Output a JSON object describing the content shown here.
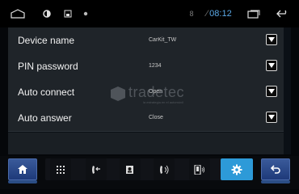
{
  "status_bar": {
    "bluetooth_text": "8",
    "time": "08:12",
    "icons": [
      "home-outline-icon",
      "circle-icon",
      "image-icon",
      "dot-icon",
      "recent-apps-icon",
      "back-arrow-icon"
    ]
  },
  "settings": {
    "rows": [
      {
        "label": "Device name",
        "value": "CarKit_TW"
      },
      {
        "label": "PIN password",
        "value": "1234"
      },
      {
        "label": "Auto connect",
        "value": "Open"
      },
      {
        "label": "Auto answer",
        "value": "Close"
      }
    ]
  },
  "watermark": {
    "text": "tradetec",
    "subtext": "la estrategia en el automóvil"
  },
  "navbar": {
    "buttons": [
      {
        "name": "home",
        "icon": "home-icon"
      },
      {
        "name": "keypad",
        "icon": "keypad-icon"
      },
      {
        "name": "call-log",
        "icon": "call-log-icon"
      },
      {
        "name": "contacts",
        "icon": "contacts-icon"
      },
      {
        "name": "call-transfer",
        "icon": "call-transfer-icon"
      },
      {
        "name": "phone-settings",
        "icon": "phone-settings-icon"
      },
      {
        "name": "settings",
        "icon": "gear-icon",
        "active": true
      },
      {
        "name": "back",
        "icon": "back-icon"
      }
    ]
  },
  "colors": {
    "accent": "#2d9ad8",
    "time": "#5aa8e6",
    "row_bg": "#1f2429"
  }
}
